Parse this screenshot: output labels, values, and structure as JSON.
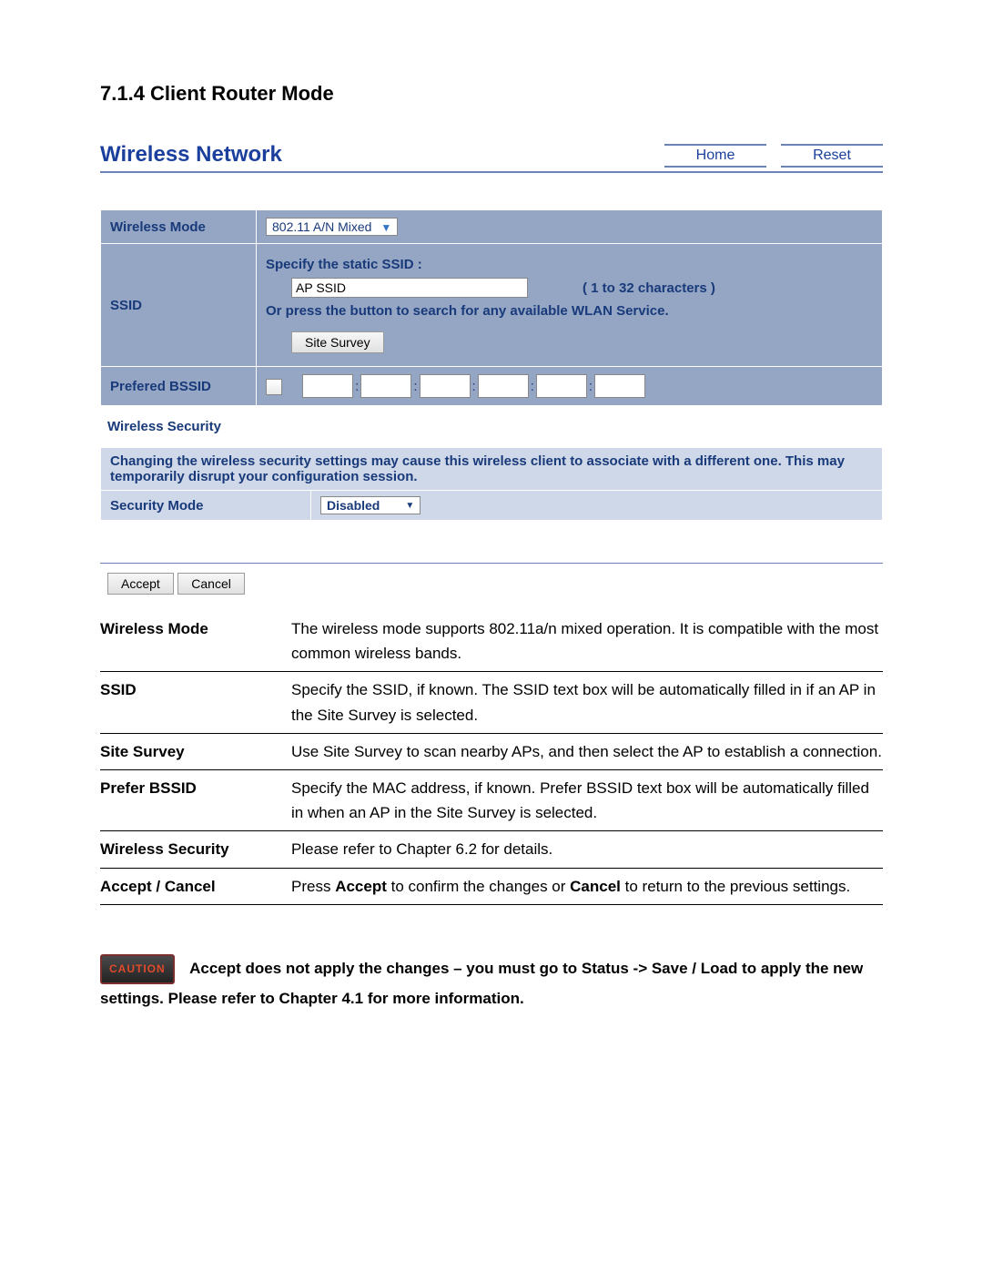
{
  "heading": "7.1.4 Client Router Mode",
  "panel": {
    "title": "Wireless Network",
    "home": "Home",
    "reset": "Reset"
  },
  "form": {
    "wireless_mode_label": "Wireless Mode",
    "wireless_mode_value": "802.11 A/N Mixed",
    "ssid_label": "SSID",
    "ssid_specify": "Specify the static SSID  :",
    "ssid_value": "AP SSID",
    "ssid_hint": "( 1 to 32 characters )",
    "ssid_or": "Or press the button to search for any available WLAN Service.",
    "site_survey": "Site Survey",
    "prefered_bssid_label": "Prefered BSSID"
  },
  "security": {
    "subheading": "Wireless Security",
    "warning": "Changing the wireless security settings may cause this wireless client to associate with a different one. This may temporarily disrupt your configuration session.",
    "mode_label": "Security Mode",
    "mode_value": "Disabled"
  },
  "actions": {
    "accept": "Accept",
    "cancel": "Cancel"
  },
  "descriptions": [
    {
      "term": "Wireless Mode",
      "def": "The wireless mode supports 802.11a/n mixed operation. It is compatible with the most common wireless bands."
    },
    {
      "term": "SSID",
      "def": "Specify the SSID, if known. The SSID text box will be automatically filled in if an AP in the Site Survey is selected."
    },
    {
      "term": "Site Survey",
      "def": "Use Site Survey to scan nearby APs, and then select the AP to establish a connection."
    },
    {
      "term": "Prefer BSSID",
      "def": "Specify the MAC address, if known. Prefer BSSID text box will be automatically filled in when an AP in the Site Survey is selected."
    },
    {
      "term": "Wireless Security",
      "def": "Please refer to Chapter 6.2 for details."
    },
    {
      "term": "Accept / Cancel",
      "def_parts": [
        "Press ",
        "Accept",
        " to confirm the changes or ",
        "Cancel",
        " to return to the previous settings."
      ]
    }
  ],
  "caution": {
    "badge": "CAUTION",
    "text": "Accept does not apply the changes – you must go to Status -> Save / Load to apply the new settings. Please refer to Chapter 4.1 for more information."
  }
}
